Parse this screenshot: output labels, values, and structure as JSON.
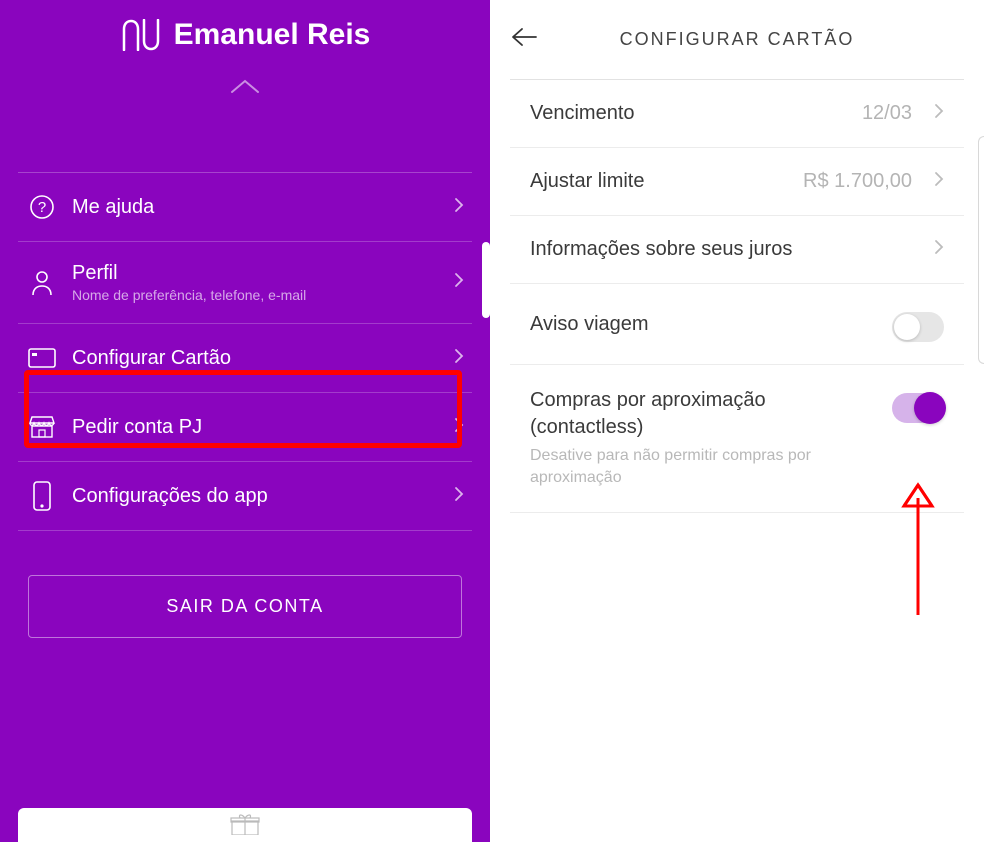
{
  "colors": {
    "brand": "#8A05BE",
    "highlight": "#ff0000"
  },
  "left": {
    "username": "Emanuel Reis",
    "menu": [
      {
        "label": "Me ajuda",
        "sub": ""
      },
      {
        "label": "Perfil",
        "sub": "Nome de preferência, telefone, e-mail"
      },
      {
        "label": "Configurar Cartão",
        "sub": ""
      },
      {
        "label": "Pedir conta PJ",
        "sub": ""
      },
      {
        "label": "Configurações do app",
        "sub": ""
      }
    ],
    "signout": "SAIR DA CONTA"
  },
  "right": {
    "title": "CONFIGURAR CARTÃO",
    "rows": {
      "vencimento_label": "Vencimento",
      "vencimento_value": "12/03",
      "limite_label": "Ajustar limite",
      "limite_value": "R$ 1.700,00",
      "juros_label": "Informações sobre seus juros",
      "aviso_label": "Aviso viagem",
      "contactless_title": "Compras por aproximação (contactless)",
      "contactless_desc": "Desative para não permitir compras por aproximação"
    },
    "toggles": {
      "aviso_viagem": false,
      "contactless": true
    }
  }
}
